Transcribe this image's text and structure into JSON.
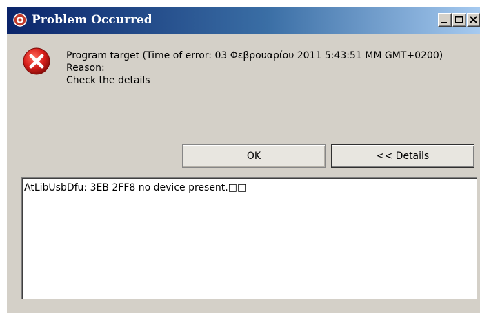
{
  "window": {
    "title": "Problem Occurred"
  },
  "titlebar_buttons": {
    "minimize_icon": "minimize-icon",
    "maximize_icon": "maximize-icon",
    "close_icon": "close-icon"
  },
  "message": {
    "icon": "error-icon",
    "line1": "Program target (Time of error: 03 Φεβρουαρίου 2011 5:43:51 ΜΜ GMT+0200)",
    "line2": "Reason:",
    "line3": "Check the details"
  },
  "buttons": {
    "ok_label": "OK",
    "details_label": "<< Details"
  },
  "details": {
    "text": "AtLibUsbDfu: 3EB 2FF8 no device present.□□"
  },
  "colors": {
    "title_gradient_start": "#0a246a",
    "title_gradient_end": "#a6caf0",
    "dialog_background": "#d4d0c8",
    "error_red": "#d8201c"
  }
}
